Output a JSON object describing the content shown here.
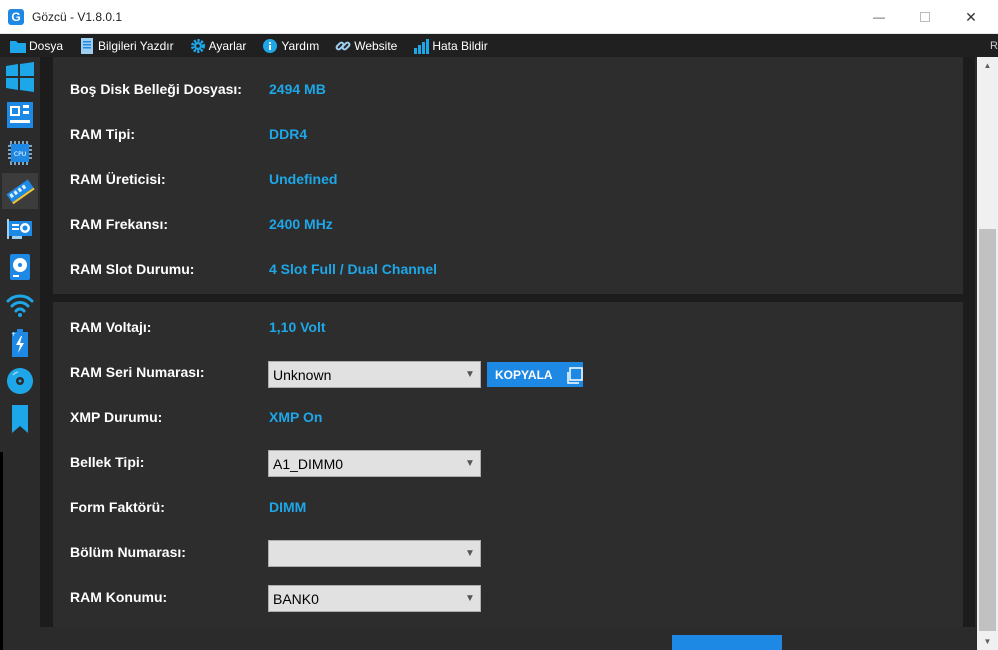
{
  "app": {
    "title": "Gözcü - V1.8.0.1",
    "logo_letter": "G"
  },
  "window_controls": {
    "minimize": "—",
    "maximize": "",
    "close": "✕"
  },
  "menu": [
    {
      "label": "Dosya",
      "icon": "folder-icon"
    },
    {
      "label": "Bilgileri Yazdır",
      "icon": "document-icon"
    },
    {
      "label": "Ayarlar",
      "icon": "gear-icon"
    },
    {
      "label": "Yardım",
      "icon": "info-icon"
    },
    {
      "label": "Website",
      "icon": "link-icon"
    },
    {
      "label": "Hata Bildir",
      "icon": "signal-icon"
    }
  ],
  "sidebar": [
    {
      "icon": "windows-icon",
      "active": false
    },
    {
      "icon": "motherboard-icon",
      "active": false
    },
    {
      "icon": "cpu-icon",
      "active": false
    },
    {
      "icon": "ram-icon",
      "active": true
    },
    {
      "icon": "gpu-icon",
      "active": false
    },
    {
      "icon": "disk-icon",
      "active": false
    },
    {
      "icon": "wifi-icon",
      "active": false
    },
    {
      "icon": "battery-icon",
      "active": false
    },
    {
      "icon": "optical-disc-icon",
      "active": false
    },
    {
      "icon": "bookmark-icon",
      "active": false
    }
  ],
  "panel1": [
    {
      "label": "Boş Disk Belleği Dosyası:",
      "value": "2494 MB"
    },
    {
      "label": "RAM Tipi:",
      "value": "DDR4"
    },
    {
      "label": "RAM Üreticisi:",
      "value": "Undefined"
    },
    {
      "label": "RAM Frekansı:",
      "value": "2400 MHz"
    },
    {
      "label": "RAM Slot Durumu:",
      "value": "4 Slot Full / Dual Channel"
    }
  ],
  "panel2": {
    "voltage": {
      "label": "RAM Voltajı:",
      "value": "1,10 Volt"
    },
    "serial": {
      "label": "RAM Seri Numarası:",
      "selected": "Unknown",
      "copy_label": "KOPYALA"
    },
    "xmp": {
      "label": "XMP Durumu:",
      "value": "XMP On"
    },
    "memory_type": {
      "label": "Bellek Tipi:",
      "selected": "A1_DIMM0"
    },
    "form_factor": {
      "label": "Form Faktörü:",
      "value": "DIMM"
    },
    "part_number": {
      "label": "Bölüm Numarası:",
      "selected": ""
    },
    "location": {
      "label": "RAM Konumu:",
      "selected": "BANK0"
    }
  },
  "colors": {
    "accent": "#1ea7e8",
    "button_blue": "#1e88e5",
    "panel": "#2d2d2d",
    "background": "#1c1c1c"
  }
}
